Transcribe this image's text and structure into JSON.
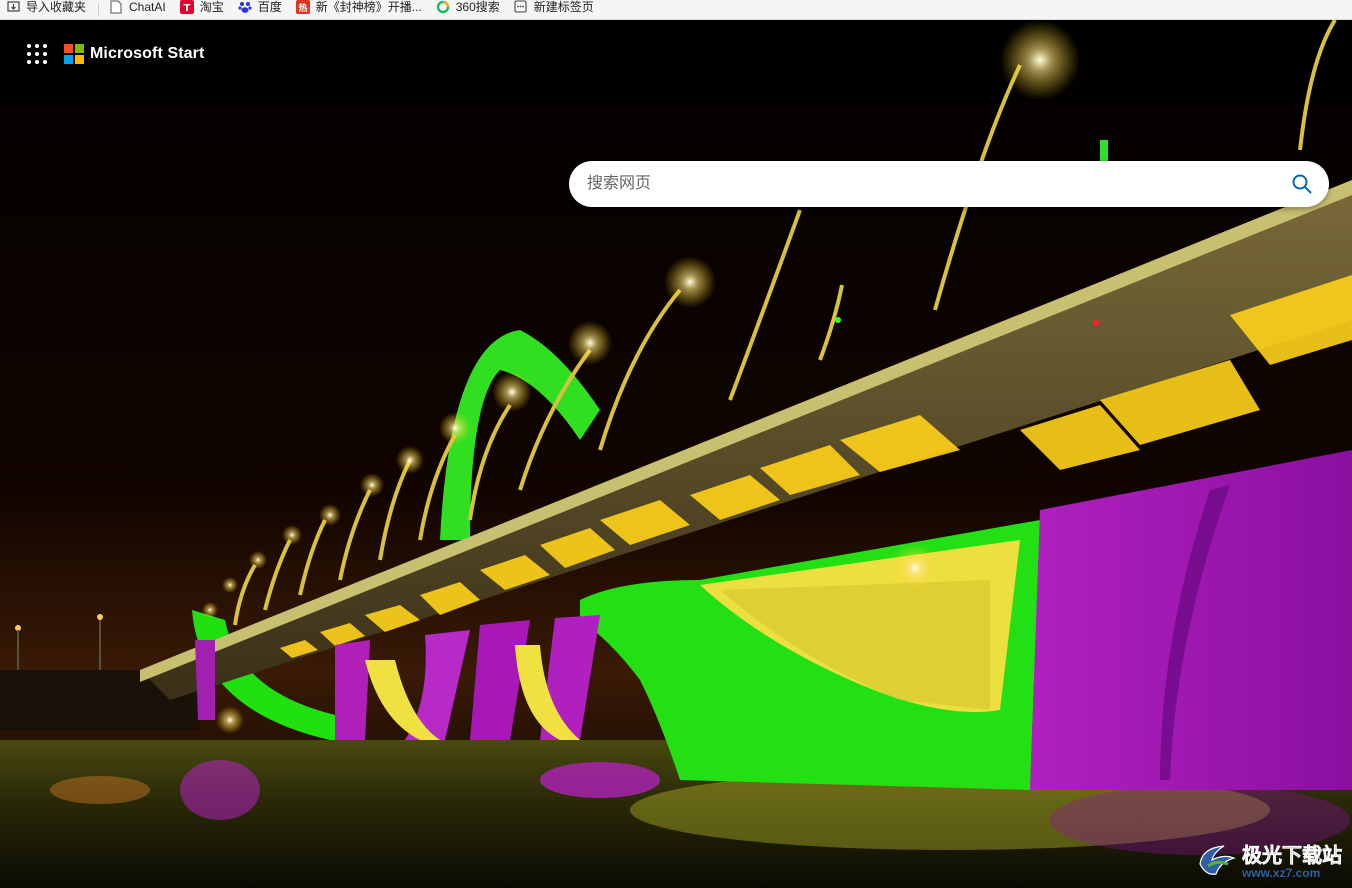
{
  "bookmarks": [
    {
      "label": "导入收藏夹",
      "icon": "import-icon",
      "color": "#444444"
    },
    {
      "label": "ChatAI",
      "icon": "page-icon",
      "color": "#444444"
    },
    {
      "label": "淘宝",
      "icon": "taobao-icon",
      "color": "#e4002b"
    },
    {
      "label": "百度",
      "icon": "baidu-icon",
      "color": "#2932e1"
    },
    {
      "label": "新《封神榜》开播...",
      "icon": "news-icon",
      "color": "#d9361b"
    },
    {
      "label": "360搜索",
      "icon": "360-icon",
      "color": "#19b955"
    },
    {
      "label": "新建标签页",
      "icon": "newtab-icon",
      "color": "#444444"
    }
  ],
  "header": {
    "brand": "Microsoft Start",
    "apps_icon": "app-launcher-icon",
    "logo_colors": [
      "#f25022",
      "#7fba00",
      "#00a4ef",
      "#ffb900"
    ]
  },
  "search": {
    "placeholder": "搜索网页",
    "icon": "search-icon",
    "icon_color": "#0067b8"
  },
  "watermark": {
    "main": "极光下载站",
    "sub": "www.xz7.com"
  }
}
